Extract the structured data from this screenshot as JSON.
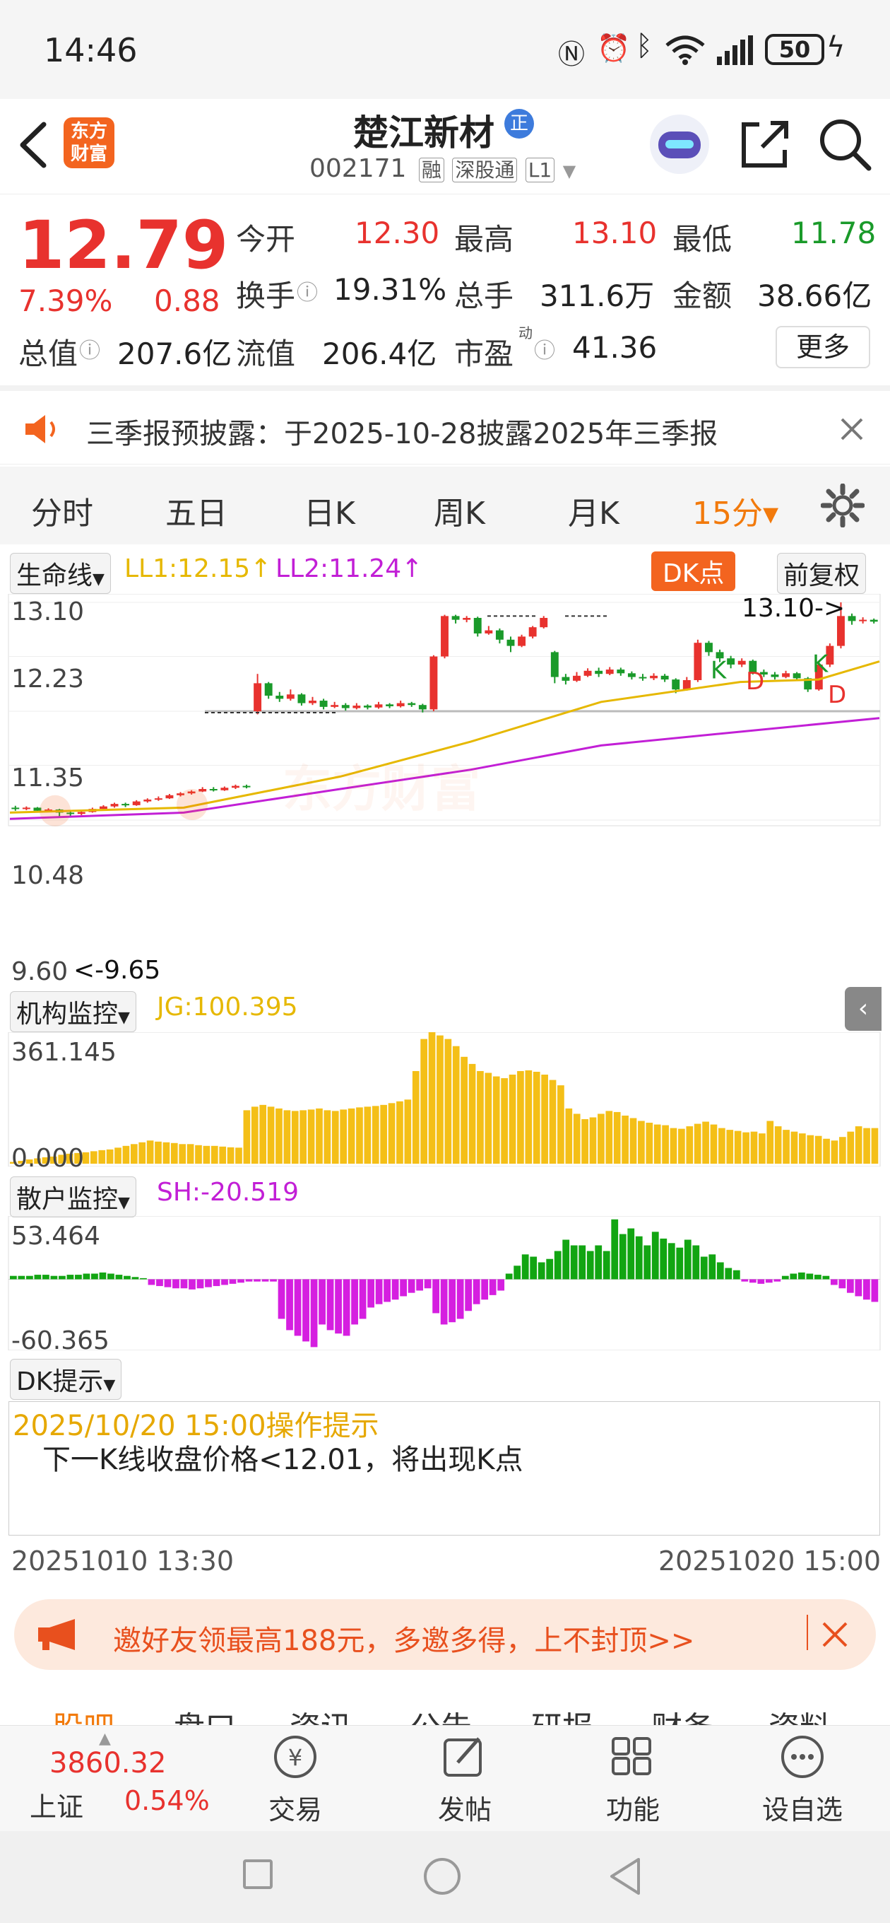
{
  "status_bar": {
    "time": "14:46",
    "battery": "50"
  },
  "header": {
    "logo_line1": "东方",
    "logo_line2": "财富",
    "stock_name": "楚江新材",
    "badge": "正",
    "code": "002171",
    "tags": [
      "融",
      "深股通",
      "L1"
    ]
  },
  "quote": {
    "price": "12.79",
    "change_pct": "7.39%",
    "change": "0.88",
    "open_label": "今开",
    "open": "12.30",
    "high_label": "最高",
    "high": "13.10",
    "low_label": "最低",
    "low": "11.78",
    "turnover_label": "换手",
    "turnover": "19.31%",
    "volume_label": "总手",
    "volume": "311.6万",
    "amount_label": "金额",
    "amount": "38.66亿",
    "mktcap_label": "总值",
    "mktcap": "207.6亿",
    "float_label": "流值",
    "float_cap": "206.4亿",
    "pe_label": "市盈",
    "pe_sup": "动",
    "pe": "41.36",
    "more_button": "更多"
  },
  "notice": {
    "text": "三季报预披露：于2025-10-28披露2025年三季报"
  },
  "tabs": [
    {
      "label": "分时"
    },
    {
      "label": "五日"
    },
    {
      "label": "日K"
    },
    {
      "label": "周K"
    },
    {
      "label": "月K"
    },
    {
      "label": "15分▾"
    }
  ],
  "chart_main": {
    "indicator": "生命线",
    "ll1": "LL1:12.15↑",
    "ll2": "LL2:11.24↑",
    "dk_button": "DK点",
    "adjust_button": "前复权",
    "y_ticks": [
      "13.10",
      "12.23",
      "11.35",
      "10.48",
      "9.60"
    ],
    "max_annot": "13.10->",
    "min_annot": "<-9.65",
    "watermark": "东方财富"
  },
  "chart_jg": {
    "indicator": "机构监控",
    "value": "JG:100.395",
    "ymax": "361.145",
    "ymin": "0.000"
  },
  "chart_sh": {
    "indicator": "散户监控",
    "value": "SH:-20.519",
    "ymax": "53.464",
    "ymin": "-60.365"
  },
  "dk_tip": {
    "label": "DK提示",
    "title": "2025/10/20 15:00操作提示",
    "body": "下一K线收盘价格<12.01，将出现K点"
  },
  "x_axis": {
    "start": "20251010 13:30",
    "end": "20251020 15:00"
  },
  "invite": {
    "text": "邀好友领最高188元，多邀多得，上不封顶>>"
  },
  "sub_tabs": [
    "股吧",
    "盘口",
    "资讯",
    "公告",
    "研报",
    "财务",
    "资料"
  ],
  "bottom_nav": {
    "index_value": "3860.32",
    "index_name": "上证",
    "index_pct": "0.54%",
    "items": [
      {
        "label": "交易"
      },
      {
        "label": "发帖"
      },
      {
        "label": "功能"
      },
      {
        "label": "设自选"
      }
    ]
  },
  "colors": {
    "up": "#e8322e",
    "down": "#1a9a2a",
    "accent": "#f27a0c",
    "ll1": "#e6b800",
    "ll2": "#c21fd6"
  },
  "chart_data": {
    "type": "candlestick",
    "ylim": [
      9.6,
      13.1
    ],
    "y_ticks": [
      "13.10",
      "12.23",
      "11.35",
      "10.48",
      "9.60"
    ],
    "x_start": "20251010 13:30",
    "x_end": "20251020 15:00",
    "candles": [
      [
        9.8,
        9.78,
        9.83,
        9.75
      ],
      [
        9.78,
        9.8,
        9.82,
        9.76
      ],
      [
        9.8,
        9.75,
        9.81,
        9.72
      ],
      [
        9.75,
        9.77,
        9.79,
        9.73
      ],
      [
        9.77,
        9.72,
        9.78,
        9.65
      ],
      [
        9.72,
        9.7,
        9.74,
        9.66
      ],
      [
        9.7,
        9.73,
        9.75,
        9.68
      ],
      [
        9.73,
        9.78,
        9.8,
        9.72
      ],
      [
        9.78,
        9.82,
        9.84,
        9.77
      ],
      [
        9.82,
        9.86,
        9.88,
        9.8
      ],
      [
        9.86,
        9.84,
        9.88,
        9.81
      ],
      [
        9.84,
        9.9,
        9.92,
        9.83
      ],
      [
        9.9,
        9.93,
        9.95,
        9.88
      ],
      [
        9.93,
        9.95,
        9.98,
        9.91
      ],
      [
        9.95,
        10.0,
        10.02,
        9.94
      ],
      [
        10.0,
        10.03,
        10.05,
        9.98
      ],
      [
        10.03,
        10.06,
        10.08,
        10.01
      ],
      [
        10.06,
        10.1,
        10.13,
        10.05
      ],
      [
        10.1,
        10.08,
        10.13,
        10.06
      ],
      [
        10.08,
        10.12,
        10.14,
        10.07
      ],
      [
        10.12,
        10.15,
        10.17,
        10.1
      ],
      [
        10.15,
        10.13,
        10.17,
        10.11
      ],
      [
        11.35,
        11.8,
        11.95,
        11.3
      ],
      [
        11.8,
        11.6,
        11.82,
        11.55
      ],
      [
        11.6,
        11.55,
        11.66,
        11.5
      ],
      [
        11.55,
        11.62,
        11.7,
        11.52
      ],
      [
        11.62,
        11.48,
        11.64,
        11.44
      ],
      [
        11.48,
        11.52,
        11.58,
        11.45
      ],
      [
        11.52,
        11.42,
        11.55,
        11.38
      ],
      [
        11.42,
        11.45,
        11.5,
        11.4
      ],
      [
        11.45,
        11.4,
        11.48,
        11.36
      ],
      [
        11.4,
        11.44,
        11.48,
        11.38
      ],
      [
        11.44,
        11.41,
        11.46,
        11.38
      ],
      [
        11.41,
        11.46,
        11.5,
        11.39
      ],
      [
        11.46,
        11.43,
        11.48,
        11.4
      ],
      [
        11.43,
        11.48,
        11.52,
        11.41
      ],
      [
        11.48,
        11.45,
        11.5,
        11.42
      ],
      [
        11.45,
        11.38,
        11.47,
        11.33
      ],
      [
        11.38,
        12.23,
        12.25,
        11.35
      ],
      [
        12.23,
        12.88,
        12.9,
        12.2
      ],
      [
        12.88,
        12.82,
        12.9,
        12.76
      ],
      [
        12.82,
        12.85,
        12.88,
        12.78
      ],
      [
        12.85,
        12.6,
        12.87,
        12.55
      ],
      [
        12.6,
        12.65,
        12.72,
        12.58
      ],
      [
        12.65,
        12.5,
        12.68,
        12.44
      ],
      [
        12.5,
        12.4,
        12.55,
        12.3
      ],
      [
        12.4,
        12.55,
        12.58,
        12.38
      ],
      [
        12.55,
        12.7,
        12.72,
        12.52
      ],
      [
        12.7,
        12.85,
        12.88,
        12.68
      ],
      [
        12.3,
        11.9,
        12.32,
        11.8
      ],
      [
        11.9,
        11.84,
        11.95,
        11.78
      ],
      [
        11.84,
        11.92,
        11.98,
        11.82
      ],
      [
        11.92,
        12.0,
        12.04,
        11.9
      ],
      [
        12.0,
        11.95,
        12.05,
        11.9
      ],
      [
        11.95,
        12.02,
        12.06,
        11.93
      ],
      [
        12.02,
        11.96,
        12.05,
        11.92
      ],
      [
        11.96,
        11.9,
        11.99,
        11.86
      ],
      [
        11.9,
        11.88,
        11.95,
        11.84
      ],
      [
        11.88,
        11.92,
        11.96,
        11.85
      ],
      [
        11.92,
        11.86,
        11.95,
        11.82
      ],
      [
        11.86,
        11.7,
        11.88,
        11.64
      ],
      [
        11.7,
        11.85,
        11.9,
        11.68
      ],
      [
        11.85,
        12.45,
        12.5,
        11.82
      ],
      [
        12.45,
        12.3,
        12.48,
        12.24
      ],
      [
        12.3,
        12.2,
        12.34,
        12.14
      ],
      [
        12.2,
        12.1,
        12.24,
        12.04
      ],
      [
        12.1,
        12.16,
        12.2,
        12.06
      ],
      [
        12.16,
        11.98,
        12.18,
        11.94
      ],
      [
        11.98,
        11.94,
        12.02,
        11.9
      ],
      [
        11.94,
        11.9,
        11.98,
        11.86
      ],
      [
        11.9,
        11.96,
        12.0,
        11.88
      ],
      [
        11.96,
        11.88,
        11.98,
        11.84
      ],
      [
        11.88,
        11.7,
        11.9,
        11.66
      ],
      [
        11.7,
        12.1,
        12.14,
        11.68
      ],
      [
        12.1,
        12.4,
        12.44,
        12.06
      ],
      [
        12.4,
        12.88,
        13.1,
        12.36
      ],
      [
        12.88,
        12.8,
        12.92,
        12.74
      ],
      [
        12.8,
        12.82,
        12.86,
        12.76
      ],
      [
        12.82,
        12.79,
        12.84,
        12.76
      ]
    ],
    "ll1_line": [
      [
        0,
        9.72
      ],
      [
        0.2,
        9.8
      ],
      [
        0.38,
        10.3
      ],
      [
        0.53,
        10.86
      ],
      [
        0.68,
        11.5
      ],
      [
        0.84,
        11.82
      ],
      [
        0.93,
        11.86
      ],
      [
        1.0,
        12.15
      ]
    ],
    "ll2_line": [
      [
        0,
        9.62
      ],
      [
        0.2,
        9.72
      ],
      [
        0.38,
        10.1
      ],
      [
        0.53,
        10.41
      ],
      [
        0.68,
        10.8
      ],
      [
        0.84,
        11.02
      ],
      [
        1.0,
        11.24
      ]
    ],
    "jg": {
      "ylim": [
        0.0,
        361.145
      ],
      "values": [
        5,
        8,
        12,
        15,
        18,
        20,
        25,
        28,
        30,
        32,
        35,
        38,
        40,
        45,
        50,
        55,
        60,
        65,
        62,
        60,
        58,
        55,
        55,
        52,
        50,
        50,
        48,
        46,
        45,
        150,
        160,
        165,
        160,
        155,
        150,
        148,
        150,
        152,
        155,
        150,
        148,
        152,
        155,
        158,
        160,
        162,
        165,
        170,
        175,
        180,
        260,
        350,
        370,
        360,
        350,
        330,
        300,
        280,
        260,
        255,
        245,
        240,
        250,
        260,
        262,
        258,
        250,
        235,
        220,
        155,
        140,
        125,
        130,
        140,
        148,
        145,
        135,
        128,
        120,
        115,
        110,
        108,
        100,
        98,
        105,
        112,
        118,
        110,
        100,
        95,
        92,
        88,
        90,
        85,
        120,
        105,
        95,
        90,
        85,
        80,
        78,
        70,
        65,
        75,
        90,
        105,
        100,
        100
      ]
    },
    "sh": {
      "ylim": [
        -60.365,
        53.464
      ],
      "values": [
        3,
        3,
        3,
        4,
        4,
        3,
        3,
        4,
        4,
        5,
        5,
        6,
        5,
        4,
        3,
        2,
        1,
        -5,
        -6,
        -7,
        -8,
        -8,
        -9,
        -8,
        -7,
        -6,
        -5,
        -4,
        -3,
        -2,
        -2,
        -2,
        -2,
        -35,
        -45,
        -50,
        -55,
        -60,
        -40,
        -45,
        -48,
        -50,
        -40,
        -35,
        -25,
        -22,
        -20,
        -18,
        -15,
        -12,
        -10,
        -8,
        -30,
        -40,
        -38,
        -35,
        -28,
        -22,
        -18,
        -14,
        -10,
        5,
        12,
        22,
        20,
        15,
        18,
        25,
        35,
        30,
        30,
        25,
        30,
        25,
        53,
        40,
        45,
        38,
        30,
        42,
        36,
        32,
        28,
        35,
        30,
        20,
        22,
        15,
        10,
        8,
        -2,
        -3,
        -4,
        -3,
        -2,
        3,
        5,
        6,
        5,
        4,
        3,
        -5,
        -8,
        -12,
        -15,
        -18,
        -20
      ]
    }
  }
}
